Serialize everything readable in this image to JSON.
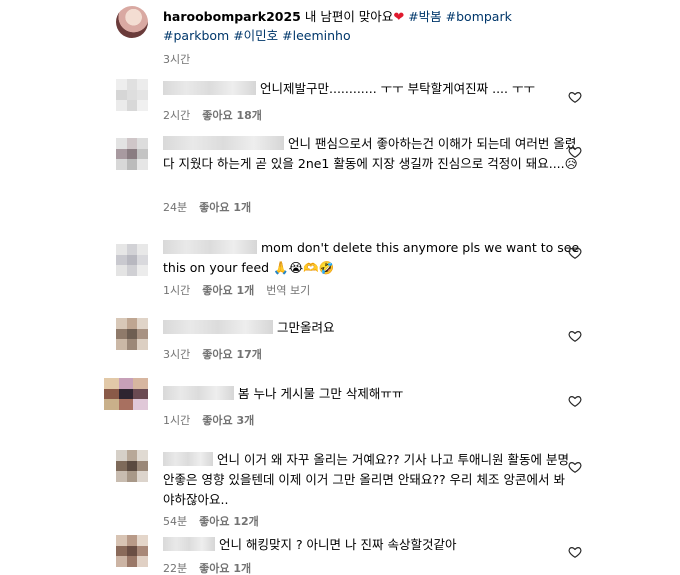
{
  "post": {
    "username": "haroobompark2025",
    "caption": " 내 남편이 맞아요",
    "caption_emoji": "❤",
    "tags_line1": [
      " #박봄",
      " #bompark"
    ],
    "tags_line2": [
      "#parkbom",
      " #이민호",
      " #leeminho"
    ],
    "time": "3시간"
  },
  "comments": [
    {
      "text": "언니제발구만............ ㅜㅜ 부탁할게여진짜 .... ㅜㅜ",
      "time": "2시간",
      "likes": "좋아요 18개",
      "translate": "",
      "avatar": [
        "#eeeeee",
        "#e0e0e0",
        "#ececec",
        "#d6d6d6",
        "#dedede",
        "#e4e4e4",
        "#ebebeb",
        "#d8d8d8",
        "#f0f0f0"
      ]
    },
    {
      "text": "언니 팬심으로서 좋아하는건 이해가 되는데 여러번 올렸다 지웠다 하는게 곧 있을 2ne1 활동에 지장 생길까 진심으로 걱정이 돼요....😥",
      "time": "24분",
      "likes": "좋아요 1개",
      "translate": "",
      "avatar": [
        "#e3e3e3",
        "#cfc6c8",
        "#dddddd",
        "#a89aa0",
        "#8a7d82",
        "#c4c4c4",
        "#d8d8d8",
        "#bbbbbb",
        "#e6e6e6"
      ]
    },
    {
      "text": "mom don't delete this anymore pls we want to see this on your feed 🙏😭🫶🤣",
      "time": "1시간",
      "likes": "좋아요 1개",
      "translate": "번역 보기",
      "avatar": [
        "#e6e6e6",
        "#d2d2d6",
        "#e8e8e8",
        "#c9c9cf",
        "#b8b8c0",
        "#d9d9dd",
        "#e4e4e4",
        "#d0d0d4",
        "#ececec"
      ]
    },
    {
      "text": "그만올려요",
      "time": "3시간",
      "likes": "좋아요 17개",
      "translate": "",
      "avatar": [
        "#d8c8b8",
        "#bfa692",
        "#e0d4c8",
        "#8f7a6a",
        "#6e5e52",
        "#a89282",
        "#cbb8a6",
        "#9c8878",
        "#dccfc2"
      ]
    },
    {
      "text": "봄 누나 게시물 그만 삭제해ㅠㅠ",
      "time": "1시간",
      "likes": "좋아요 3개",
      "translate": "",
      "avatar": [
        "#e2c9a8",
        "#c7a0b8",
        "#d7b6a0",
        "#8a5a48",
        "#2e2430",
        "#6a4a52",
        "#c9b08a",
        "#a87060",
        "#e0c8d8"
      ]
    },
    {
      "text": "언니 이거 왜 자꾸 올리는 거예요?? 기사 나고 투애니원 활동에 분명 안좋은 영향 있을텐데 이제 이거 그만 올리면 안돼요?? 우리 체조 앙콘에서 봐야하잖아요..",
      "time": "54분",
      "likes": "좋아요 12개",
      "translate": "",
      "avatar": [
        "#d6d0c8",
        "#b8a898",
        "#e0dad2",
        "#7e6a5a",
        "#5a4a40",
        "#9a8878",
        "#c8bcb0",
        "#a89888",
        "#dcd4cc"
      ]
    },
    {
      "text": "언니 해킹맞지 ? 아니면 나 진짜 속상할것같아",
      "time": "22분",
      "likes": "좋아요 1개",
      "translate": "",
      "avatar": [
        "#d8c4b4",
        "#b89a88",
        "#e4d6ca",
        "#8a6a5a",
        "#6a4e44",
        "#a88878",
        "#ccb4a4",
        "#9a7868",
        "#e0d0c4"
      ]
    }
  ]
}
